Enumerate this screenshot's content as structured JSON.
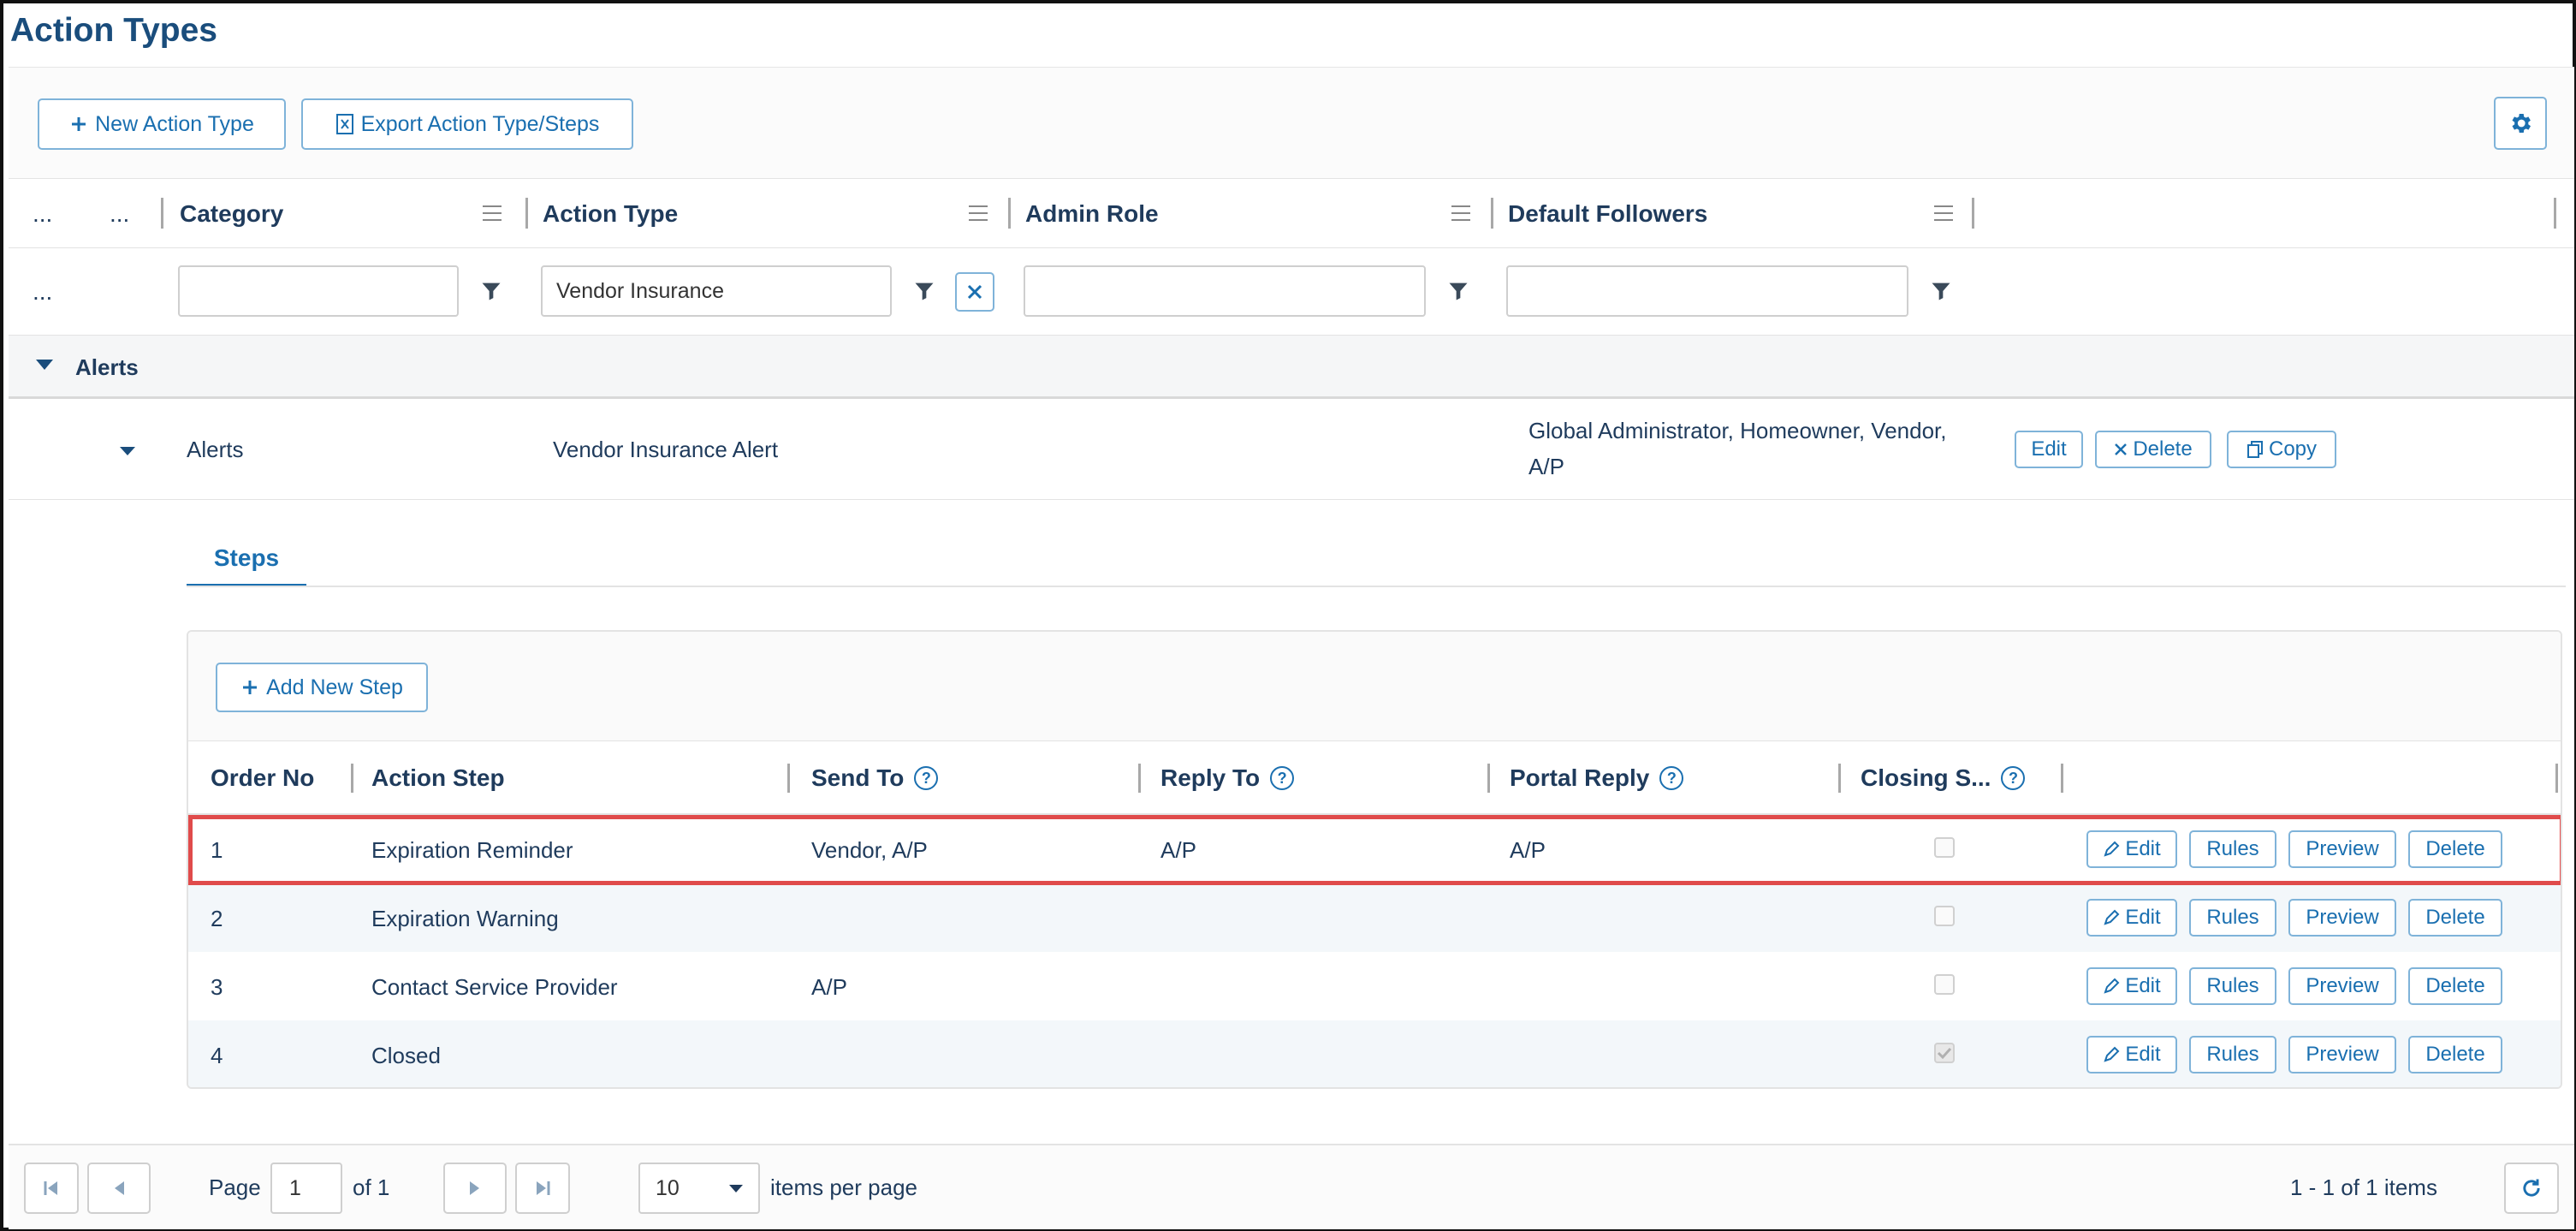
{
  "page": {
    "title": "Action Types"
  },
  "toolbar": {
    "new_label": "New Action Type",
    "export_label": "Export Action Type/Steps"
  },
  "grid": {
    "columns": {
      "c1": "...",
      "c2": "...",
      "category": "Category",
      "action_type": "Action Type",
      "admin_role": "Admin Role",
      "default_followers": "Default Followers"
    },
    "filters": {
      "lead": "...",
      "category": "",
      "action_type": "Vendor Insurance",
      "admin_role": "",
      "default_followers": ""
    },
    "group": {
      "label": "Alerts"
    },
    "row": {
      "category": "Alerts",
      "action_type": "Vendor Insurance Alert",
      "followers_line1": "Global Administrator, Homeowner, Vendor,",
      "followers_line2": "A/P",
      "edit": "Edit",
      "delete": "Delete",
      "copy": "Copy"
    }
  },
  "detail": {
    "tab": "Steps",
    "add_step": "Add New Step",
    "columns": {
      "order_no": "Order No",
      "action_step": "Action Step",
      "send_to": "Send To",
      "reply_to": "Reply To",
      "portal_reply": "Portal Reply",
      "closing": "Closing S..."
    },
    "help_glyph": "?",
    "row_buttons": {
      "edit": "Edit",
      "rules": "Rules",
      "preview": "Preview",
      "delete": "Delete"
    },
    "steps": [
      {
        "order": "1",
        "name": "Expiration Reminder",
        "send_to": "Vendor, A/P",
        "reply_to": "A/P",
        "portal_reply": "A/P",
        "closing": false
      },
      {
        "order": "2",
        "name": "Expiration Warning",
        "send_to": "",
        "reply_to": "",
        "portal_reply": "",
        "closing": false
      },
      {
        "order": "3",
        "name": "Contact Service Provider",
        "send_to": "A/P",
        "reply_to": "",
        "portal_reply": "",
        "closing": false
      },
      {
        "order": "4",
        "name": "Closed",
        "send_to": "",
        "reply_to": "",
        "portal_reply": "",
        "closing": true
      }
    ]
  },
  "pager": {
    "page_label": "Page",
    "page_value": "1",
    "of_label": "of 1",
    "page_size": "10",
    "items_per_page": "items per page",
    "summary": "1 - 1 of 1 items"
  },
  "colors": {
    "accent": "#1a6fb0",
    "title": "#1a4d7c",
    "highlight": "#e04b4b"
  },
  "icons": [
    "plus-icon",
    "excel-icon",
    "gear-icon",
    "column-menu-icon",
    "filter-icon",
    "clear-filter-icon",
    "caret-down-icon",
    "x-icon",
    "copy-icon",
    "pencil-icon",
    "help-icon",
    "first-page-icon",
    "prev-page-icon",
    "next-page-icon",
    "last-page-icon",
    "refresh-icon"
  ]
}
